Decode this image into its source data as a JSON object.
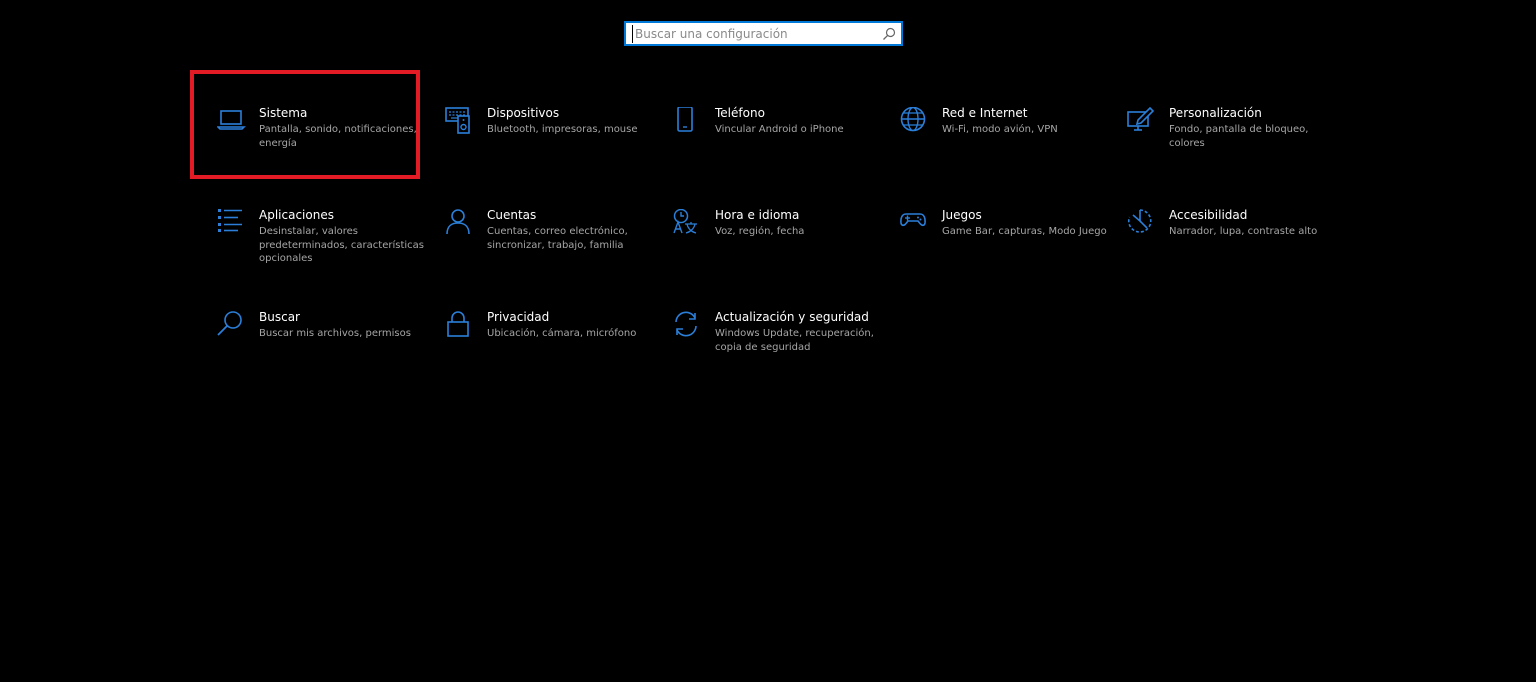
{
  "search": {
    "placeholder": "Buscar una configuración"
  },
  "colors": {
    "accent": "#0078d7",
    "icon": "#2b7fd9",
    "highlight": "#e21b24",
    "background": "#000000"
  },
  "tiles": [
    {
      "title": "Sistema",
      "desc": "Pantalla, sonido, notificaciones, energía",
      "icon": "laptop-icon",
      "highlighted": true
    },
    {
      "title": "Dispositivos",
      "desc": "Bluetooth, impresoras, mouse",
      "icon": "devices-icon"
    },
    {
      "title": "Teléfono",
      "desc": "Vincular Android o iPhone",
      "icon": "phone-icon"
    },
    {
      "title": "Red e Internet",
      "desc": "Wi-Fi, modo avión, VPN",
      "icon": "globe-icon"
    },
    {
      "title": "Personalización",
      "desc": "Fondo, pantalla de bloqueo, colores",
      "icon": "personalization-icon"
    },
    {
      "title": "Aplicaciones",
      "desc": "Desinstalar, valores predeterminados, características opcionales",
      "icon": "apps-list-icon"
    },
    {
      "title": "Cuentas",
      "desc": "Cuentas, correo electrónico, sincronizar, trabajo, familia",
      "icon": "person-icon"
    },
    {
      "title": "Hora e idioma",
      "desc": "Voz, región, fecha",
      "icon": "time-language-icon"
    },
    {
      "title": "Juegos",
      "desc": "Game Bar, capturas, Modo Juego",
      "icon": "gamepad-icon"
    },
    {
      "title": "Accesibilidad",
      "desc": "Narrador, lupa, contraste alto",
      "icon": "accessibility-icon"
    },
    {
      "title": "Buscar",
      "desc": "Buscar mis archivos, permisos",
      "icon": "magnifier-icon"
    },
    {
      "title": "Privacidad",
      "desc": "Ubicación, cámara, micrófono",
      "icon": "lock-icon"
    },
    {
      "title": "Actualización y seguridad",
      "desc": "Windows Update, recuperación, copia de seguridad",
      "icon": "update-icon"
    }
  ]
}
